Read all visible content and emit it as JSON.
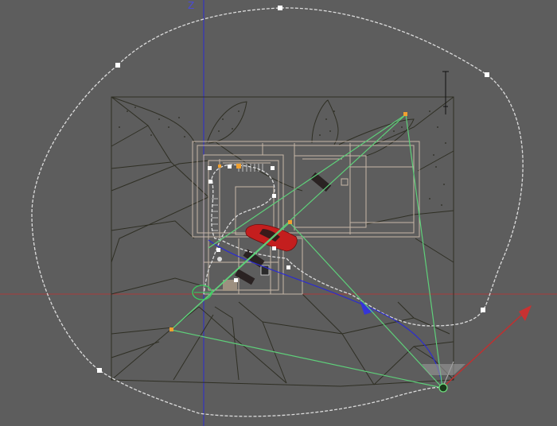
{
  "viewport": {
    "axis_label_z": "Z",
    "background": "#5d5d5d",
    "colors": {
      "axis_x": "#b03a3a",
      "axis_z": "#3838c8",
      "terrain_lines": "#2e2e22",
      "house_lines": "#c9b8a8",
      "path_spline": "#dedede",
      "camera_frustum": "#5fd07a",
      "target_arrow": "#3a3ad8",
      "gizmo_arrow": "#c03030",
      "car": "#c41e1e",
      "handle": "#f0a030",
      "vertex": "#ffffff"
    }
  }
}
